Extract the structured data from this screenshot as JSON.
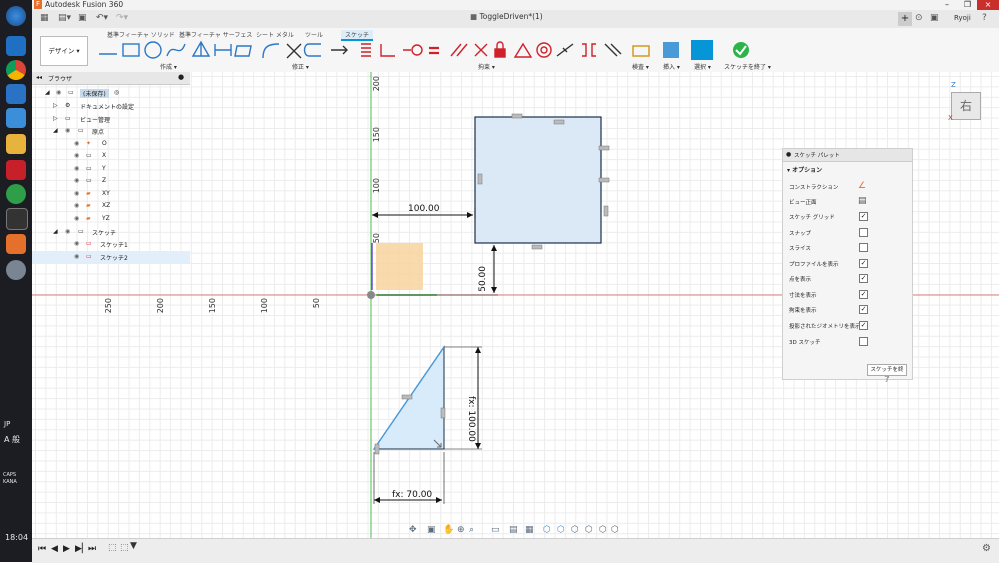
{
  "app": {
    "title": "Autodesk Fusion 360",
    "user": "Ryoji",
    "document_title": "ToggleDriven*(1)"
  },
  "taskbar": {
    "lang": "JP",
    "ime": "A 般",
    "time": "18:04",
    "conn_label": "CAPS",
    "kana_label": "KANA"
  },
  "ribbon": {
    "workspace": "デザイン",
    "tabs": [
      "基準フィーチャ ソリッド",
      "基準フィーチャ サーフェス",
      "シート メタル",
      "ツール",
      "スケッチ"
    ],
    "active_tab": "スケッチ",
    "groups": {
      "create": "作成",
      "modify": "修正",
      "constraints": "拘束",
      "inspect": "検査",
      "insert": "挿入",
      "select": "選択",
      "finish": "スケッチを終了"
    }
  },
  "browser": {
    "title": "ブラウザ",
    "items": [
      {
        "label": "(未保存)",
        "level": 0
      },
      {
        "label": "ドキュメントの設定",
        "level": 1
      },
      {
        "label": "ビュー管理",
        "level": 1
      },
      {
        "label": "原点",
        "level": 1
      },
      {
        "label": "O",
        "level": 2
      },
      {
        "label": "X",
        "level": 2
      },
      {
        "label": "Y",
        "level": 2
      },
      {
        "label": "Z",
        "level": 2
      },
      {
        "label": "XY",
        "level": 2
      },
      {
        "label": "XZ",
        "level": 2
      },
      {
        "label": "YZ",
        "level": 2
      },
      {
        "label": "スケッチ",
        "level": 1
      },
      {
        "label": "スケッチ1",
        "level": 2
      },
      {
        "label": "スケッチ2",
        "level": 2
      }
    ]
  },
  "canvas": {
    "ruler_v": [
      "200",
      "150",
      "100",
      "50"
    ],
    "ruler_h": [
      "250",
      "200",
      "150",
      "100",
      "50"
    ],
    "dims": {
      "d1": "100.00",
      "d2": "50.00",
      "d3": "fx: 100.00",
      "d4": "fx: 70.00"
    },
    "viewcube": {
      "face": "右",
      "axis_z": "Z",
      "axis_x": "X"
    }
  },
  "palette": {
    "title": "スケッチ パレット",
    "section": "オプション",
    "rows": [
      {
        "label": "コンストラクション",
        "type": "icon",
        "checked": false
      },
      {
        "label": "ビュー正面",
        "type": "icon",
        "checked": false
      },
      {
        "label": "スケッチ グリッド",
        "type": "check",
        "checked": true
      },
      {
        "label": "スナップ",
        "type": "check",
        "checked": false
      },
      {
        "label": "スライス",
        "type": "check",
        "checked": false
      },
      {
        "label": "プロファイルを表示",
        "type": "check",
        "checked": true
      },
      {
        "label": "点を表示",
        "type": "check",
        "checked": true
      },
      {
        "label": "寸法を表示",
        "type": "check",
        "checked": true
      },
      {
        "label": "拘束を表示",
        "type": "check",
        "checked": true
      },
      {
        "label": "投影されたジオメトリを表示",
        "type": "check",
        "checked": true
      },
      {
        "label": "3D スケッチ",
        "type": "check",
        "checked": false
      }
    ],
    "finish_button": "スケッチを終了"
  },
  "colors": {
    "accent": "#0696d7",
    "finish_green": "#2cb34a",
    "constraint_red": "#d0202a",
    "profile_fill": "#dbe9f6",
    "orange_fill": "#f8d39d"
  }
}
